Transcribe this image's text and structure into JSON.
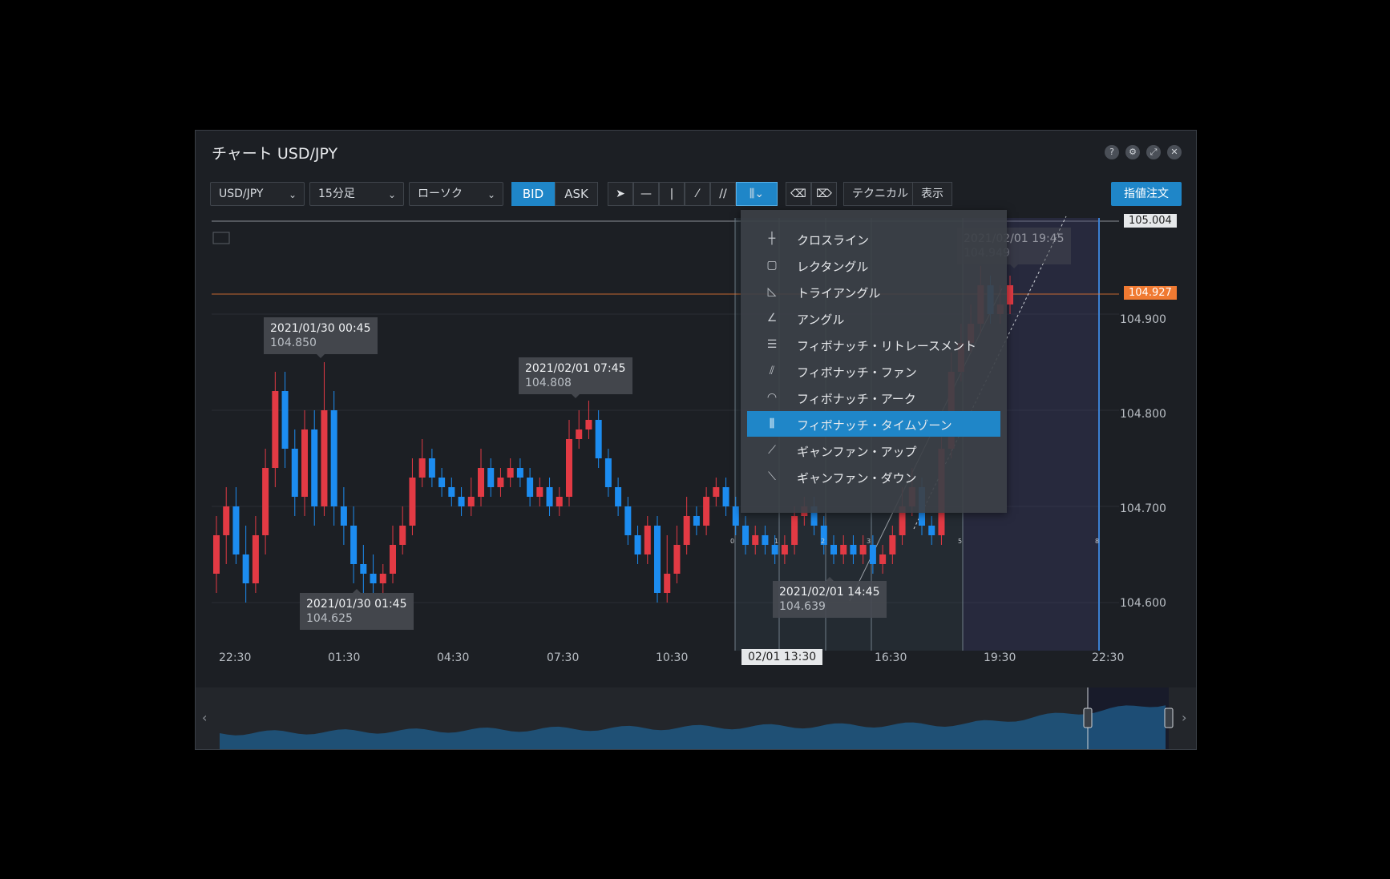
{
  "window": {
    "title": "チャート USD/JPY"
  },
  "win_icons": [
    "?",
    "⚙",
    "⤢",
    "✕"
  ],
  "toolbar": {
    "symbol": "USD/JPY",
    "timeframe": "15分足",
    "chart_style": "ローソク",
    "bid": "BID",
    "ask": "ASK",
    "technical": "テクニカル",
    "display": "表示",
    "order": "指値注文"
  },
  "menu": {
    "items": [
      {
        "label": "クロスライン",
        "icon": "cross-line-icon"
      },
      {
        "label": "レクタングル",
        "icon": "rectangle-icon"
      },
      {
        "label": "トライアングル",
        "icon": "triangle-icon"
      },
      {
        "label": "アングル",
        "icon": "angle-icon"
      },
      {
        "label": "フィボナッチ・リトレースメント",
        "icon": "fibonacci-retracement-icon"
      },
      {
        "label": "フィボナッチ・ファン",
        "icon": "fibonacci-fan-icon"
      },
      {
        "label": "フィボナッチ・アーク",
        "icon": "fibonacci-arc-icon"
      },
      {
        "label": "フィボナッチ・タイムゾーン",
        "icon": "fibonacci-timezone-icon"
      },
      {
        "label": "ギャンファン・アップ",
        "icon": "gann-fan-up-icon"
      },
      {
        "label": "ギャンファン・ダウン",
        "icon": "gann-fan-down-icon"
      }
    ],
    "selected_index": 7
  },
  "tooltips": [
    {
      "time": "2021/01/30 00:45",
      "value": "104.850"
    },
    {
      "time": "2021/02/01 07:45",
      "value": "104.808"
    },
    {
      "time": "2021/01/30 01:45",
      "value": "104.625"
    },
    {
      "time": "2021/02/01 14:45",
      "value": "104.639"
    },
    {
      "time": "2021/02/01 19:45",
      "value": "104.949"
    }
  ],
  "price_axis": [
    "104.900",
    "104.800",
    "104.700",
    "104.600"
  ],
  "price_tags": {
    "top": "105.004",
    "current": "104.927"
  },
  "time_axis": [
    "22:30",
    "01:30",
    "04:30",
    "07:30",
    "10:30",
    "16:30",
    "19:30",
    "22:30"
  ],
  "time_cursor": "02/01 13:30",
  "fib_zone_numbers": [
    "0",
    "1",
    "2",
    "3",
    "5",
    "8"
  ],
  "colors": {
    "up": "#1c8cf0",
    "down": "#e23a44",
    "accent": "#1f86c8",
    "current": "#f07a32"
  },
  "chart_data": {
    "type": "candlestick",
    "ylim": [
      104.55,
      105.0
    ],
    "values": [
      [
        104.63,
        104.67,
        104.61,
        104.69
      ],
      [
        104.67,
        104.7,
        104.64,
        104.72
      ],
      [
        104.7,
        104.65,
        104.64,
        104.72
      ],
      [
        104.65,
        104.62,
        104.6,
        104.68
      ],
      [
        104.62,
        104.67,
        104.61,
        104.69
      ],
      [
        104.67,
        104.74,
        104.65,
        104.76
      ],
      [
        104.74,
        104.82,
        104.72,
        104.84
      ],
      [
        104.82,
        104.76,
        104.74,
        104.84
      ],
      [
        104.76,
        104.71,
        104.69,
        104.78
      ],
      [
        104.71,
        104.78,
        104.69,
        104.8
      ],
      [
        104.78,
        104.7,
        104.68,
        104.8
      ],
      [
        104.7,
        104.8,
        104.69,
        104.85
      ],
      [
        104.8,
        104.7,
        104.68,
        104.82
      ],
      [
        104.7,
        104.68,
        104.66,
        104.72
      ],
      [
        104.68,
        104.64,
        104.62,
        104.7
      ],
      [
        104.64,
        104.63,
        104.61,
        104.66
      ],
      [
        104.63,
        104.62,
        104.61,
        104.65
      ],
      [
        104.62,
        104.63,
        104.61,
        104.64
      ],
      [
        104.63,
        104.66,
        104.62,
        104.68
      ],
      [
        104.66,
        104.68,
        104.65,
        104.7
      ],
      [
        104.68,
        104.73,
        104.67,
        104.75
      ],
      [
        104.73,
        104.75,
        104.72,
        104.77
      ],
      [
        104.75,
        104.73,
        104.72,
        104.76
      ],
      [
        104.73,
        104.72,
        104.71,
        104.74
      ],
      [
        104.72,
        104.71,
        104.7,
        104.73
      ],
      [
        104.71,
        104.7,
        104.69,
        104.72
      ],
      [
        104.7,
        104.71,
        104.69,
        104.73
      ],
      [
        104.71,
        104.74,
        104.7,
        104.76
      ],
      [
        104.74,
        104.72,
        104.71,
        104.75
      ],
      [
        104.72,
        104.73,
        104.71,
        104.74
      ],
      [
        104.73,
        104.74,
        104.72,
        104.75
      ],
      [
        104.74,
        104.73,
        104.72,
        104.75
      ],
      [
        104.73,
        104.71,
        104.7,
        104.74
      ],
      [
        104.71,
        104.72,
        104.7,
        104.73
      ],
      [
        104.72,
        104.7,
        104.69,
        104.73
      ],
      [
        104.7,
        104.71,
        104.69,
        104.72
      ],
      [
        104.71,
        104.77,
        104.7,
        104.79
      ],
      [
        104.77,
        104.78,
        104.76,
        104.8
      ],
      [
        104.78,
        104.79,
        104.77,
        104.81
      ],
      [
        104.79,
        104.75,
        104.74,
        104.8
      ],
      [
        104.75,
        104.72,
        104.71,
        104.76
      ],
      [
        104.72,
        104.7,
        104.69,
        104.73
      ],
      [
        104.7,
        104.67,
        104.66,
        104.71
      ],
      [
        104.67,
        104.65,
        104.64,
        104.68
      ],
      [
        104.65,
        104.68,
        104.64,
        104.69
      ],
      [
        104.68,
        104.61,
        104.6,
        104.69
      ],
      [
        104.61,
        104.63,
        104.6,
        104.67
      ],
      [
        104.63,
        104.66,
        104.62,
        104.68
      ],
      [
        104.66,
        104.69,
        104.65,
        104.71
      ],
      [
        104.69,
        104.68,
        104.67,
        104.7
      ],
      [
        104.68,
        104.71,
        104.67,
        104.72
      ],
      [
        104.71,
        104.72,
        104.7,
        104.73
      ],
      [
        104.72,
        104.7,
        104.69,
        104.73
      ],
      [
        104.7,
        104.68,
        104.67,
        104.71
      ],
      [
        104.68,
        104.66,
        104.65,
        104.69
      ],
      [
        104.66,
        104.67,
        104.65,
        104.68
      ],
      [
        104.67,
        104.66,
        104.65,
        104.68
      ],
      [
        104.66,
        104.65,
        104.64,
        104.67
      ],
      [
        104.65,
        104.66,
        104.64,
        104.67
      ],
      [
        104.66,
        104.69,
        104.65,
        104.7
      ],
      [
        104.69,
        104.7,
        104.68,
        104.71
      ],
      [
        104.7,
        104.68,
        104.67,
        104.71
      ],
      [
        104.68,
        104.66,
        104.65,
        104.69
      ],
      [
        104.66,
        104.65,
        104.64,
        104.67
      ],
      [
        104.65,
        104.66,
        104.64,
        104.67
      ],
      [
        104.66,
        104.65,
        104.64,
        104.67
      ],
      [
        104.65,
        104.66,
        104.64,
        104.67
      ],
      [
        104.66,
        104.64,
        104.63,
        104.67
      ],
      [
        104.64,
        104.65,
        104.63,
        104.66
      ],
      [
        104.65,
        104.67,
        104.64,
        104.68
      ],
      [
        104.67,
        104.7,
        104.66,
        104.72
      ],
      [
        104.7,
        104.72,
        104.69,
        104.74
      ],
      [
        104.72,
        104.68,
        104.67,
        104.73
      ],
      [
        104.68,
        104.67,
        104.66,
        104.69
      ],
      [
        104.67,
        104.76,
        104.66,
        104.78
      ],
      [
        104.76,
        104.84,
        104.75,
        104.86
      ],
      [
        104.84,
        104.87,
        104.83,
        104.89
      ],
      [
        104.87,
        104.89,
        104.86,
        104.91
      ],
      [
        104.89,
        104.93,
        104.88,
        104.95
      ],
      [
        104.93,
        104.9,
        104.89,
        104.94
      ],
      [
        104.9,
        104.91,
        104.89,
        104.93
      ],
      [
        104.91,
        104.93,
        104.9,
        104.94
      ]
    ]
  }
}
